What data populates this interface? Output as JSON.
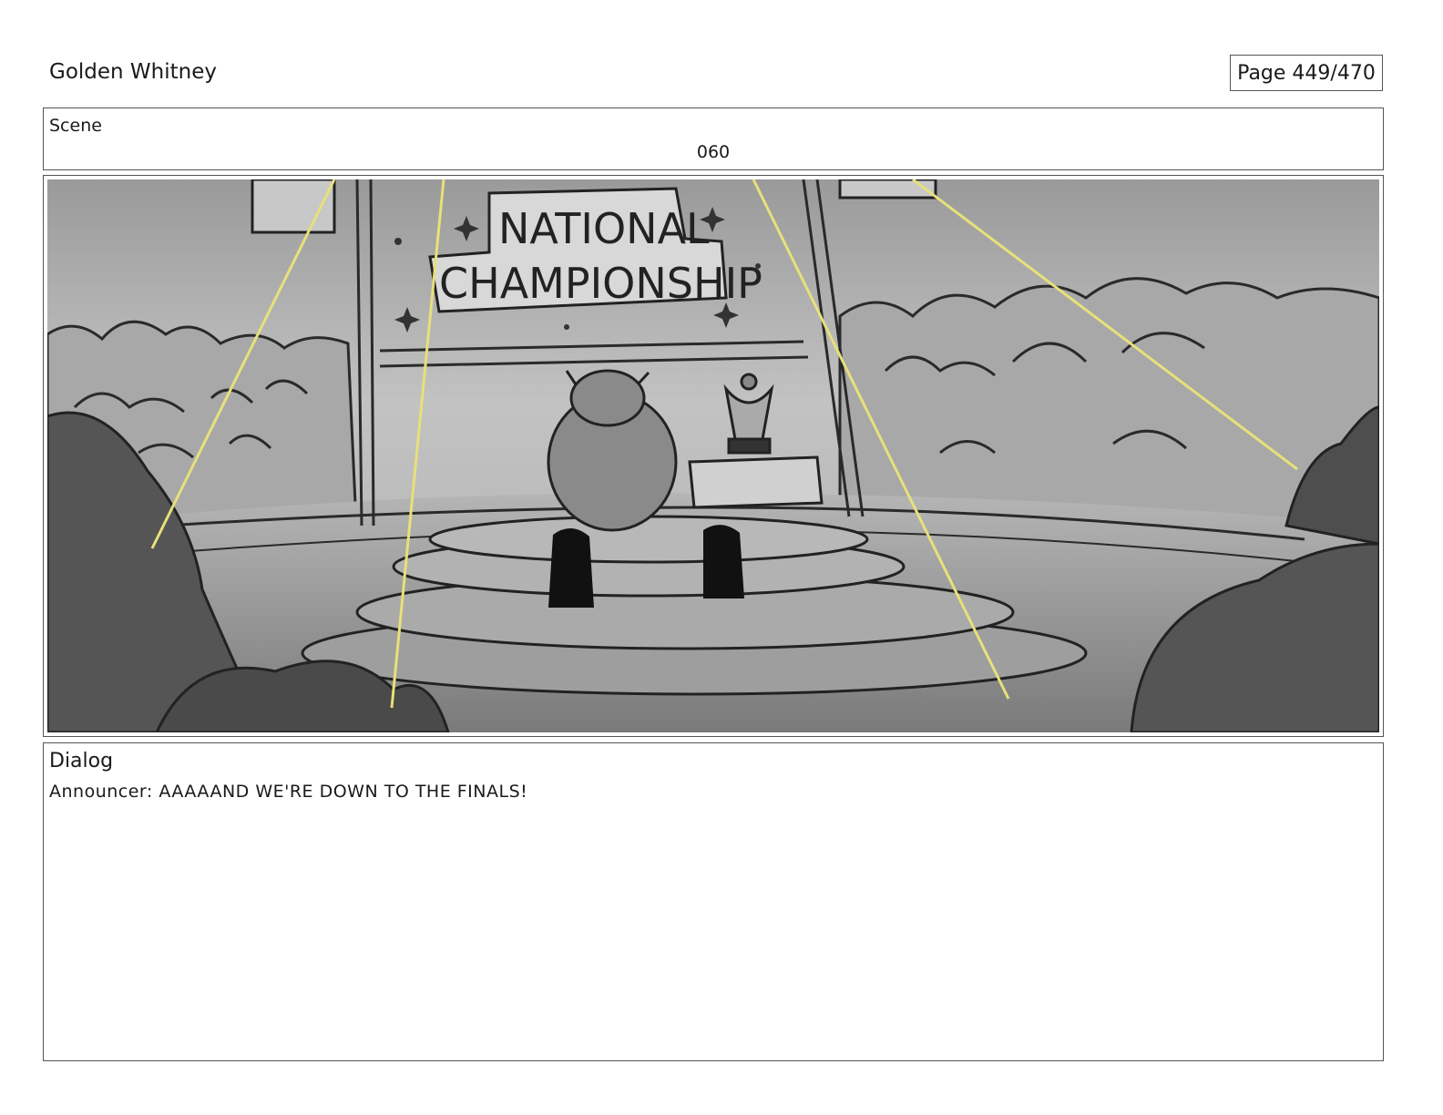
{
  "header": {
    "title": "Golden Whitney",
    "page": "Page 449/470"
  },
  "scene": {
    "label": "Scene",
    "number": "060"
  },
  "panel": {
    "sign_line1": "NATIONAL",
    "sign_line2": "CHAMPIONSHIP"
  },
  "dialog": {
    "label": "Dialog",
    "text": "Announcer: AAAAAND WE'RE DOWN TO THE FINALS!"
  },
  "colors": {
    "spotlight": "#e8e07a",
    "sketch_line": "#222222"
  }
}
